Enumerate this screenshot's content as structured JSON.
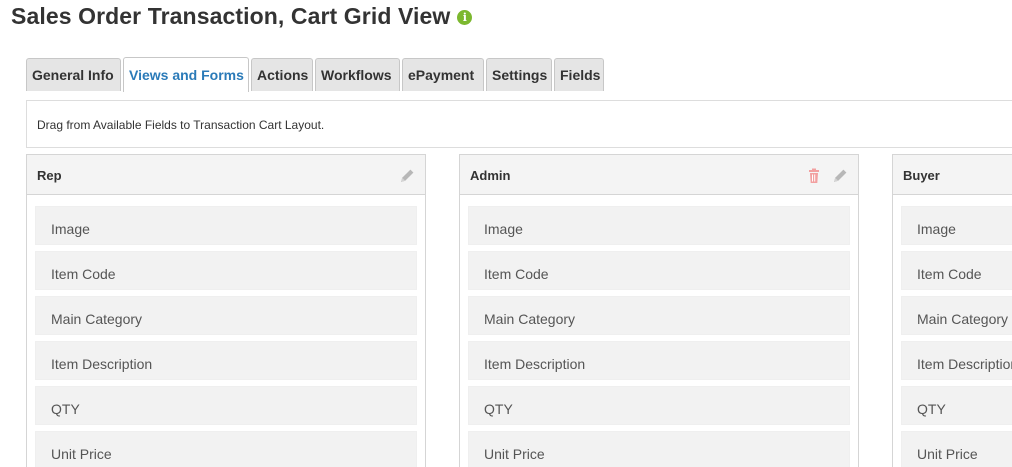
{
  "page": {
    "title": "Sales Order Transaction, Cart Grid View",
    "info_icon": "info-icon"
  },
  "tabs": [
    {
      "label": "General Info",
      "active": false
    },
    {
      "label": "Views and Forms",
      "active": true
    },
    {
      "label": "Actions",
      "active": false
    },
    {
      "label": "Workflows",
      "active": false
    },
    {
      "label": "ePayment",
      "active": false
    },
    {
      "label": "Settings",
      "active": false
    },
    {
      "label": "Fields",
      "active": false
    }
  ],
  "instruction": {
    "text": "Drag from Available Fields to Transaction Cart Layout."
  },
  "colors": {
    "accent": "#2a7ab8",
    "info_icon": "#7cb82f",
    "trash_icon": "#f2a0a0",
    "pencil_icon": "#b7b7b7"
  },
  "panels": [
    {
      "title": "Rep",
      "icons": [
        "pencil-icon"
      ],
      "fields": [
        "Image",
        "Item Code",
        "Main Category",
        "Item Description",
        "QTY",
        "Unit Price"
      ]
    },
    {
      "title": "Admin",
      "icons": [
        "trash-icon",
        "pencil-icon"
      ],
      "fields": [
        "Image",
        "Item Code",
        "Main Category",
        "Item Description",
        "QTY",
        "Unit Price"
      ]
    },
    {
      "title": "Buyer",
      "icons": [],
      "fields": [
        "Image",
        "Item Code",
        "Main Category",
        "Item Description",
        "QTY",
        "Unit Price"
      ]
    }
  ]
}
